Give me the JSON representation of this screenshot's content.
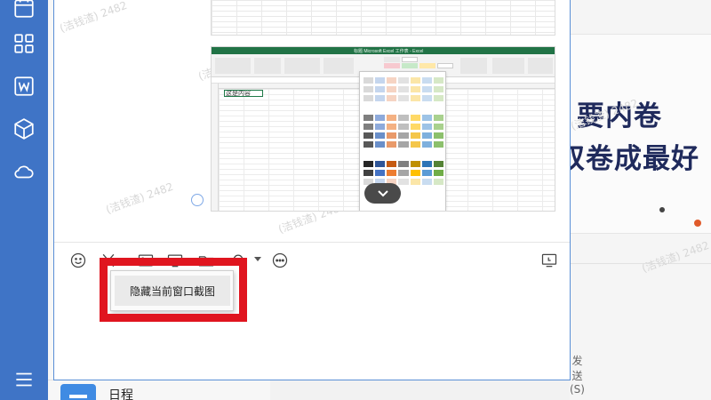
{
  "rail": {
    "icons": [
      "calendar-icon",
      "apps-grid-icon",
      "word-doc-icon",
      "cube-icon",
      "cloud-icon",
      "menu-icon"
    ],
    "accent": "#3f74c6"
  },
  "chat": {
    "watermark_text": "(洁钱渣) 2482",
    "excel_preview": {
      "title_text": "标题 Microsoft Excel 工作表 - Excel",
      "cell_a1": "这是内容"
    }
  },
  "toolbar": {
    "icons": [
      "emoji-icon",
      "scissors-icon",
      "image-icon",
      "screen-icon",
      "folder-icon",
      "bell-icon",
      "more-icon",
      "history-icon"
    ]
  },
  "context_menu": {
    "item_label": "隐藏当前窗口截图"
  },
  "send_label": "发送(S)",
  "sidebar_list": {
    "schedule_label": "日程"
  },
  "article": {
    "line1": "要内卷",
    "line2": "双卷成最好"
  },
  "colors": {
    "highlight": "#e0151f",
    "excel_green": "#217346",
    "send_text": "#666666"
  }
}
